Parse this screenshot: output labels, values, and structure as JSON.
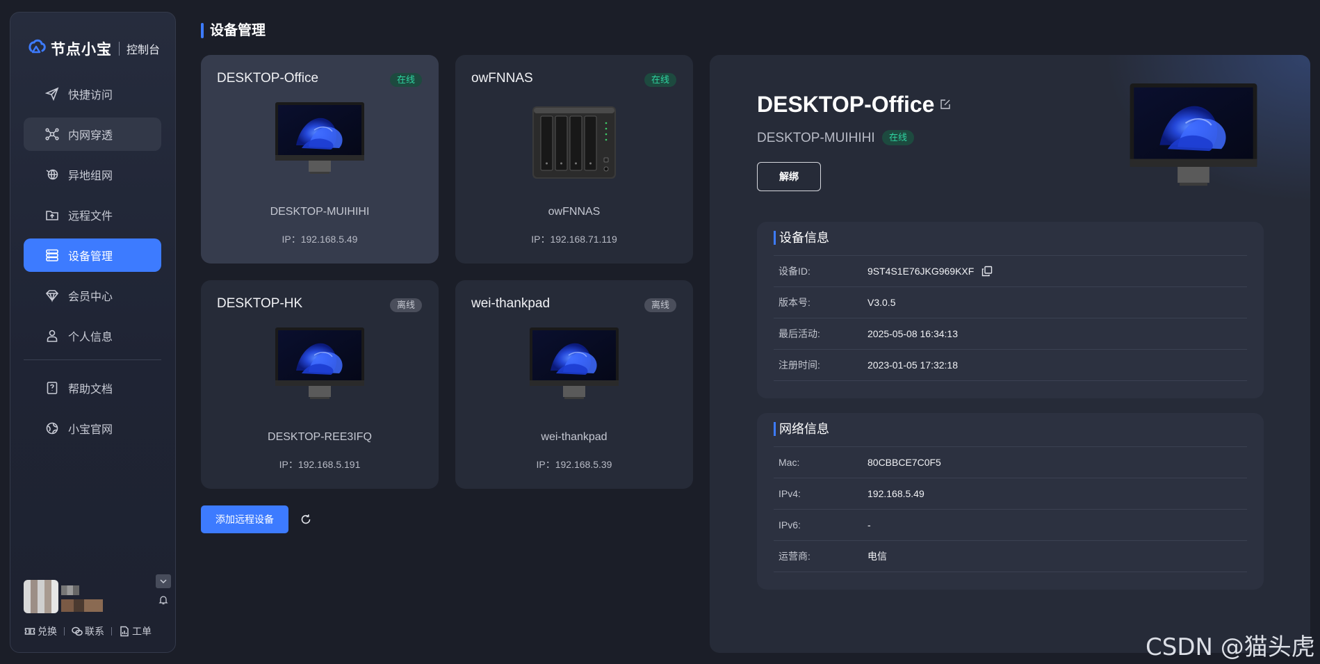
{
  "brand": {
    "name": "节点小宝",
    "subtitle": "控制台"
  },
  "nav": {
    "items": [
      {
        "label": "快捷访问",
        "icon": "send-icon"
      },
      {
        "label": "内网穿透",
        "icon": "network-nodes-icon"
      },
      {
        "label": "异地组网",
        "icon": "globe-link-icon"
      },
      {
        "label": "远程文件",
        "icon": "folder-upload-icon"
      },
      {
        "label": "设备管理",
        "icon": "device-list-icon",
        "active": true
      },
      {
        "label": "会员中心",
        "icon": "diamond-icon"
      },
      {
        "label": "个人信息",
        "icon": "person-icon"
      },
      {
        "label": "帮助文档",
        "icon": "help-doc-icon"
      },
      {
        "label": "小宝官网",
        "icon": "globe-icon"
      }
    ]
  },
  "footer": {
    "redeem": "兑换",
    "contact": "联系",
    "ticket": "工单"
  },
  "page": {
    "title": "设备管理"
  },
  "devices": [
    {
      "name": "DESKTOP-Office",
      "status": "在线",
      "hostname": "DESKTOP-MUIHIHI",
      "ip": "IP：192.168.5.49",
      "type": "monitor",
      "selected": true
    },
    {
      "name": "owFNNAS",
      "status": "在线",
      "hostname": "owFNNAS",
      "ip": "IP：192.168.71.119",
      "type": "nas"
    },
    {
      "name": "DESKTOP-HK",
      "status": "离线",
      "hostname": "DESKTOP-REE3IFQ",
      "ip": "IP：192.168.5.191",
      "type": "monitor"
    },
    {
      "name": "wei-thankpad",
      "status": "离线",
      "hostname": "wei-thankpad",
      "ip": "IP：192.168.5.39",
      "type": "monitor"
    }
  ],
  "actions": {
    "add_device": "添加远程设备"
  },
  "detail": {
    "title": "DESKTOP-Office",
    "hostname": "DESKTOP-MUIHIHI",
    "status": "在线",
    "unbind": "解绑",
    "device_info": {
      "title": "设备信息",
      "rows": [
        {
          "key": "设备ID:",
          "value": "9ST4S1E76JKG969KXF"
        },
        {
          "key": "版本号:",
          "value": "V3.0.5"
        },
        {
          "key": "最后活动:",
          "value": "2025-05-08 16:34:13"
        },
        {
          "key": "注册时间:",
          "value": "2023-01-05 17:32:18"
        }
      ]
    },
    "network_info": {
      "title": "网络信息",
      "rows": [
        {
          "key": "Mac:",
          "value": "80CBBCE7C0F5"
        },
        {
          "key": "IPv4:",
          "value": "192.168.5.49"
        },
        {
          "key": "IPv6:",
          "value": "-"
        },
        {
          "key": "运营商:",
          "value": "电信"
        }
      ]
    }
  },
  "watermark": "CSDN @猫头虎",
  "colors": {
    "accent": "#3d7bff",
    "online": "#2ed3a0",
    "background": "#1b1e28",
    "card": "#262b38"
  }
}
